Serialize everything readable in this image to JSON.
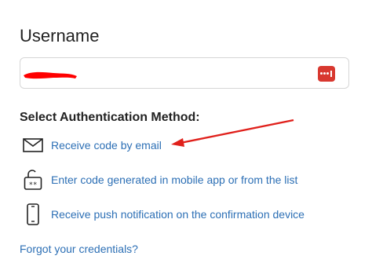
{
  "title": "Username",
  "username": {
    "value": ""
  },
  "section_heading": "Select Authentication Method:",
  "methods": [
    {
      "label": "Receive code by email",
      "icon": "envelope-icon"
    },
    {
      "label": "Enter code generated in mobile app or from the list",
      "icon": "unlock-code-icon"
    },
    {
      "label": "Receive push notification on the confirmation device",
      "icon": "smartphone-icon"
    }
  ],
  "forgot_link": "Forgot your credentials?",
  "colors": {
    "link": "#2c6fb5",
    "annotation": "#e0201b",
    "password_manager": "#d8382f"
  }
}
